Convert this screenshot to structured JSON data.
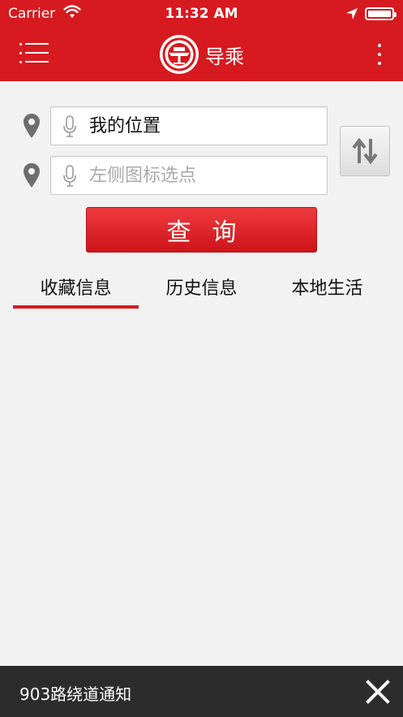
{
  "status_bar": {
    "carrier": "Carrier",
    "time": "11:32 AM"
  },
  "nav": {
    "title": "导乘"
  },
  "route": {
    "origin_value": "我的位置",
    "destination_placeholder": "左侧图标选点"
  },
  "search": {
    "label": "查询"
  },
  "tabs": [
    {
      "label": "收藏信息",
      "active": true
    },
    {
      "label": "历史信息",
      "active": false
    },
    {
      "label": "本地生活",
      "active": false
    }
  ],
  "notice": {
    "text": "903路绕道通知"
  },
  "colors": {
    "brand_red": "#d71a1f",
    "notice_bg": "#2c2c2c",
    "page_bg": "#f2f2f2"
  },
  "icons": {
    "menu": "list-menu-icon",
    "logo": "bus-logo-icon",
    "more": "more-vertical-icon",
    "pin": "location-pin-icon",
    "mic": "microphone-icon",
    "swap": "swap-icon",
    "close": "close-icon"
  }
}
